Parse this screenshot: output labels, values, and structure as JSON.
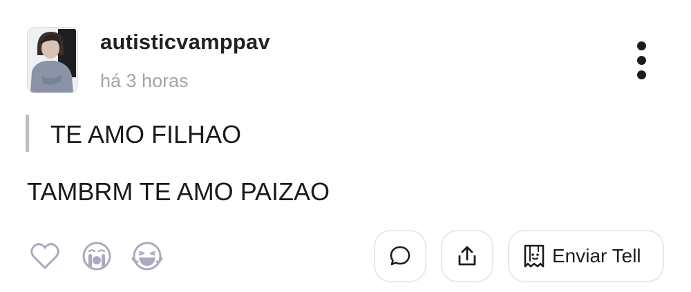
{
  "post": {
    "username": "autisticvamppav",
    "timestamp": "há 3 horas",
    "quote_text": "TE AMO FILHAO",
    "reply_text": "TAMBRM TE AMO PAIZAO"
  },
  "actions": {
    "send_label": "Enviar Tell"
  },
  "icons": {
    "menu": "kebab-menu-icon",
    "like": "heart-icon",
    "react_cry": "crying-face-icon",
    "react_laugh": "laughing-face-icon",
    "comment": "speech-bubble-icon",
    "share": "share-upload-icon",
    "send": "tell-ghost-icon"
  },
  "colors": {
    "icon_muted": "#a9a9bf",
    "text": "#1c1c1c",
    "timestamp": "#a4a4a4",
    "quote_bar": "#bdbdbd",
    "pill_border": "#e9e9ee"
  }
}
